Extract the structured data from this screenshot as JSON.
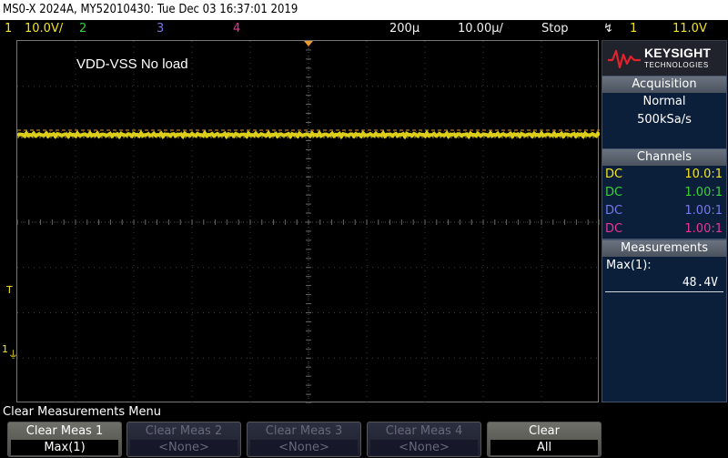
{
  "title_bar": "MS0-X 2024A, MY52010430: Tue Dec 03 16:37:01 2019",
  "status": {
    "ch1_num": "1",
    "ch1_scale": "10.0V/",
    "ch2_num": "2",
    "ch3_num": "3",
    "ch4_num": "4",
    "time_position": "200µ",
    "time_scale": "10.00µ/",
    "run_state": "Stop",
    "trigger_source": "1",
    "trigger_level": "11.0V"
  },
  "annotation": "VDD-VSS No load",
  "markers": {
    "trigger_marker": "T",
    "ch1_ground_marker": "1"
  },
  "logo": {
    "name": "KEYSIGHT",
    "sub": "TECHNOLOGIES"
  },
  "acquisition": {
    "header": "Acquisition",
    "mode": "Normal",
    "rate": "500kSa/s"
  },
  "channels": {
    "header": "Channels",
    "rows": [
      {
        "coupling": "DC",
        "probe": "10.0:1"
      },
      {
        "coupling": "DC",
        "probe": "1.00:1"
      },
      {
        "coupling": "DC",
        "probe": "1.00:1"
      },
      {
        "coupling": "DC",
        "probe": "1.00:1"
      }
    ]
  },
  "measurements": {
    "header": "Measurements",
    "label": "Max(1):",
    "value": "48.4V"
  },
  "menu": {
    "title": "Clear Measurements Menu",
    "softkeys": [
      {
        "top": "Clear Meas 1",
        "bottom": "Max(1)"
      },
      {
        "top": "Clear Meas 2",
        "bottom": "<None>"
      },
      {
        "top": "Clear Meas 3",
        "bottom": "<None>"
      },
      {
        "top": "Clear Meas 4",
        "bottom": "<None>"
      },
      {
        "top": "Clear",
        "bottom": "All"
      }
    ]
  },
  "colors": {
    "ch1": "#f5e41c",
    "ch2": "#3ad13a",
    "ch3": "#7777ee",
    "ch4": "#ee3399",
    "trigger_level_line": "#e89a2a",
    "grid": "#3c3c3c"
  }
}
